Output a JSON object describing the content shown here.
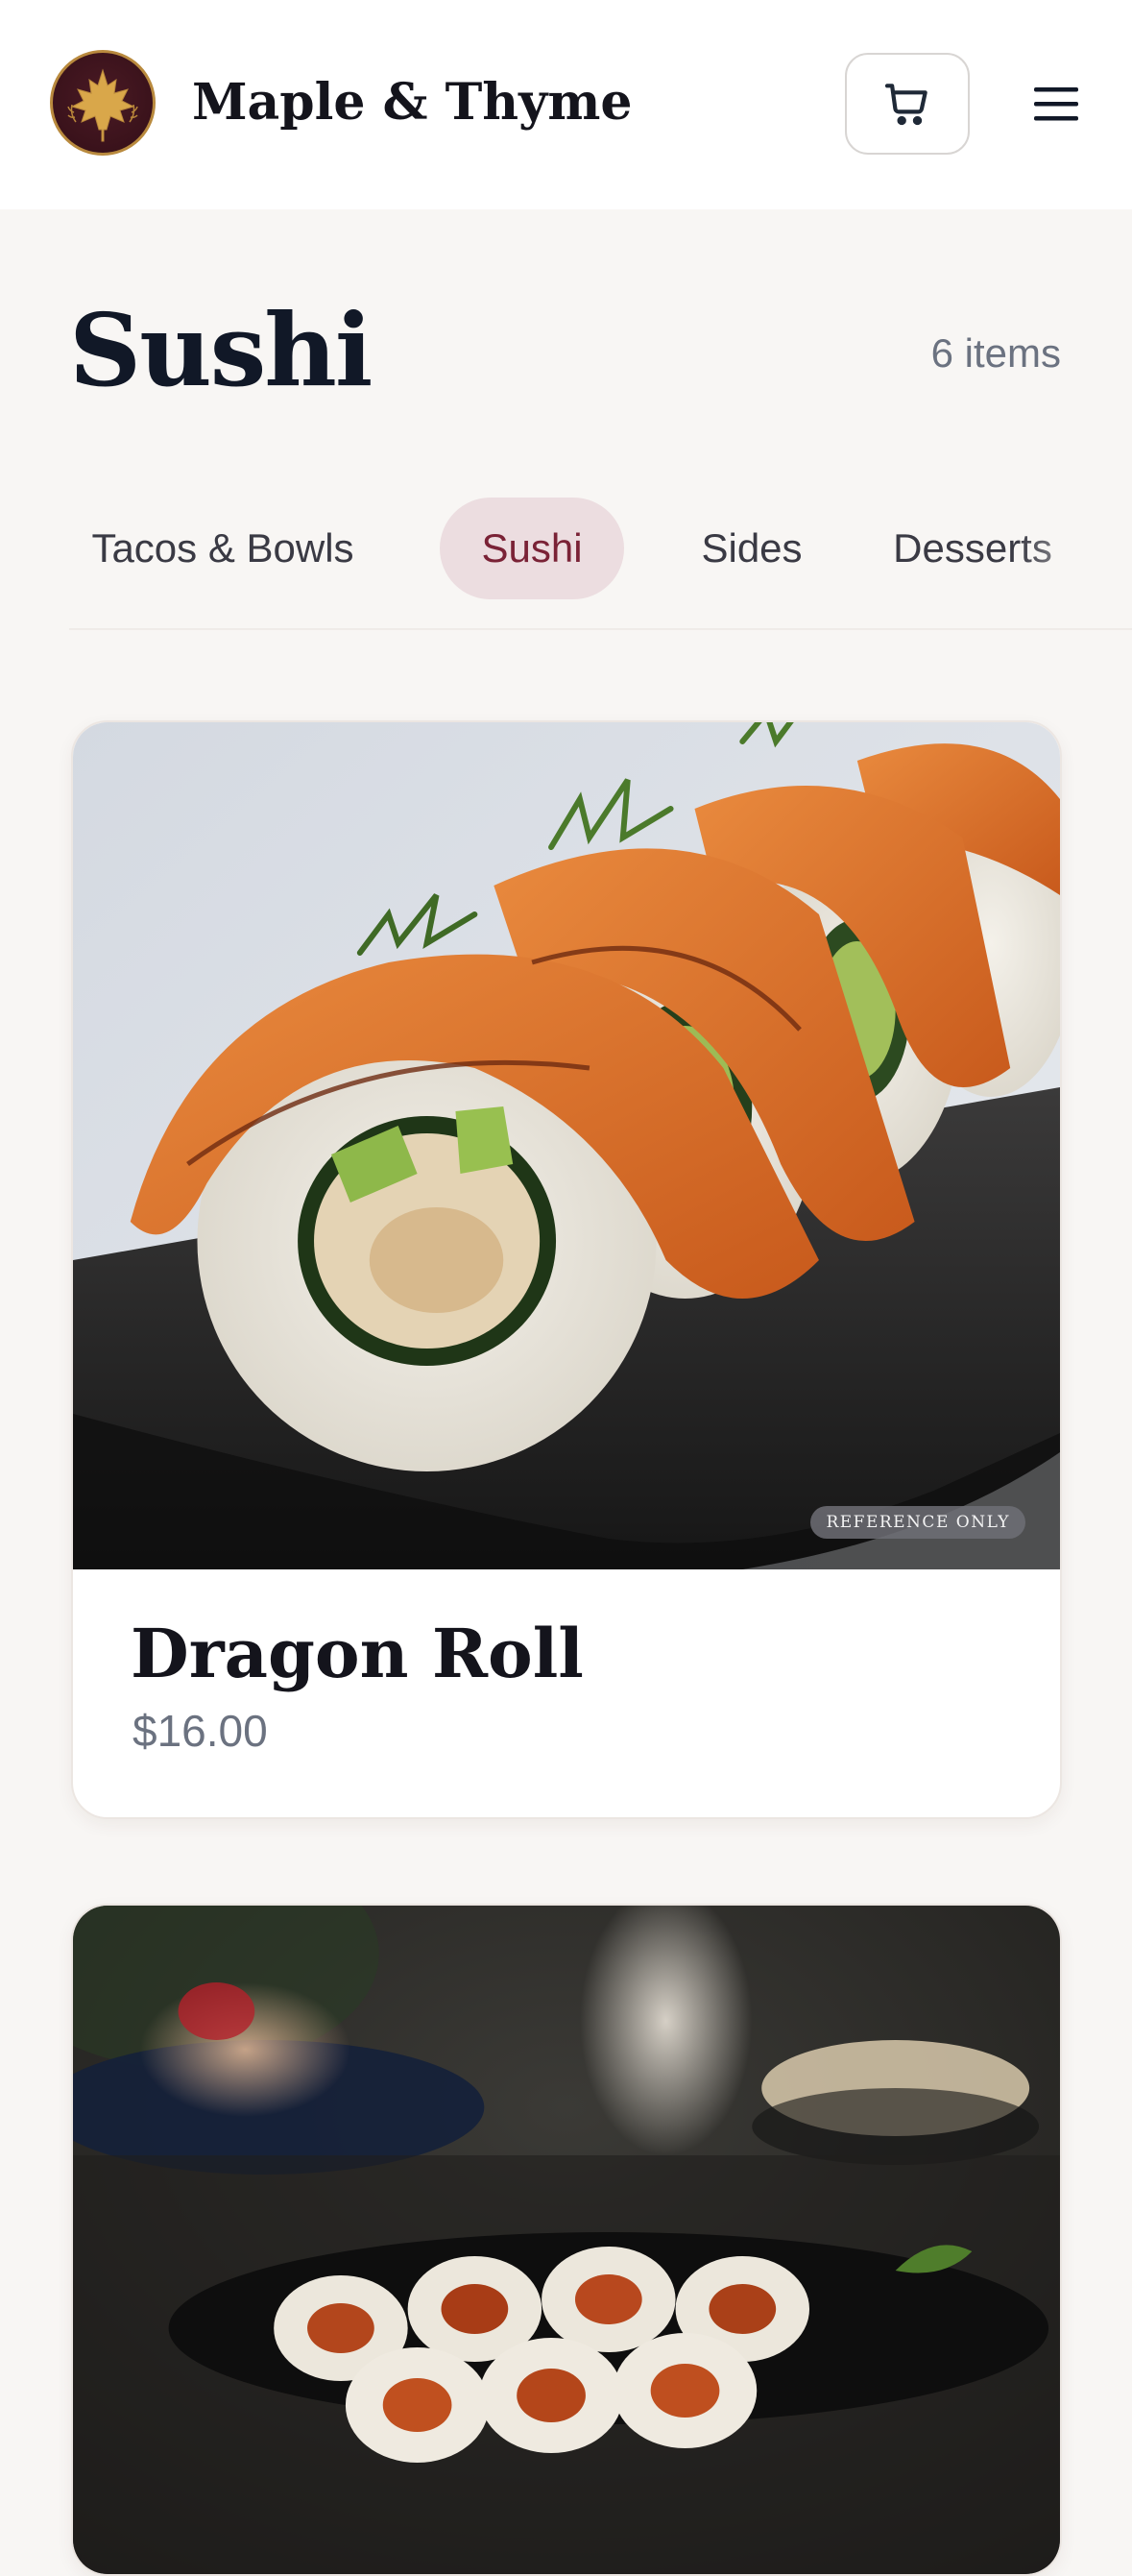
{
  "header": {
    "brand": "Maple & Thyme",
    "logo_icon": "maple-leaf-icon",
    "cart_icon": "cart-icon",
    "menu_icon": "hamburger-menu-icon"
  },
  "section": {
    "title": "Sushi",
    "count": "6 items"
  },
  "tabs": [
    {
      "label": "Tacos & Bowls",
      "active": false
    },
    {
      "label": "Sushi",
      "active": true
    },
    {
      "label": "Sides",
      "active": false
    },
    {
      "label": "Desserts",
      "active": false
    }
  ],
  "items": [
    {
      "name": "Dragon Roll",
      "price": "$16.00",
      "badge": "REFERENCE ONLY"
    },
    {
      "name": "",
      "price": "",
      "badge": ""
    }
  ],
  "colors": {
    "accent": "#7a2236",
    "accent_bg": "#ecdde0",
    "text": "#111827",
    "muted": "#6b7280",
    "page_bg": "#f8f6f4"
  }
}
